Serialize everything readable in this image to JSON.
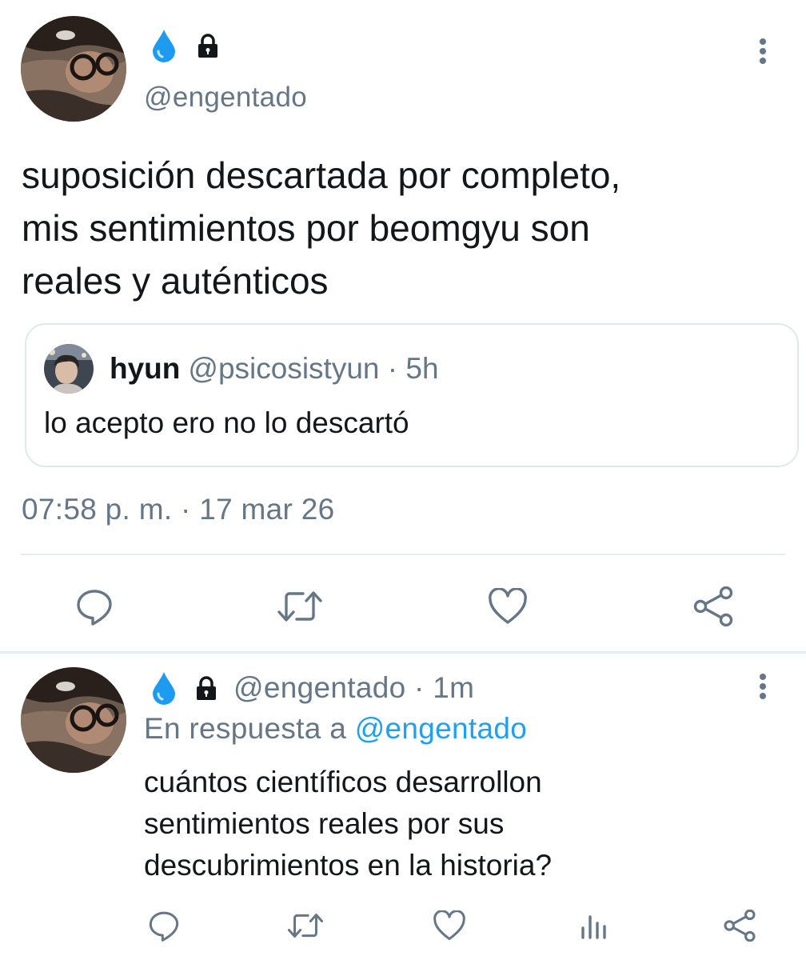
{
  "main_tweet": {
    "display_name_emoji": "💧🔒",
    "handle": "@engentado",
    "text": "suposición descartada por completo,\nmis sentimientos por beomgyu son\nreales y auténticos",
    "timestamp": "07:58 p. m. · 17 mar 26",
    "quoted_tweet": {
      "name": "hyun",
      "meta": "@psicosistyun · 5h",
      "text": "lo acepto ero no lo descartó"
    },
    "actions": [
      "reply-icon",
      "retweet-icon",
      "like-icon",
      "share-icon"
    ]
  },
  "reply_tweet": {
    "handle_meta": "@engentado · 1m",
    "context_prefix": "En respuesta a",
    "context_mention": "@engentado",
    "text": "cuántos científicos desarrollon\nsentimientos reales por sus\ndescubrimientos en la historia?",
    "actions": [
      "reply-icon",
      "retweet-icon",
      "like-icon",
      "analytics-icon",
      "share-icon"
    ]
  },
  "colors": {
    "text_primary": "#14171a",
    "text_secondary": "#657786",
    "link": "#1da1f2",
    "divider": "#e6ecf0",
    "drop_blue": "#1d9bf0"
  }
}
